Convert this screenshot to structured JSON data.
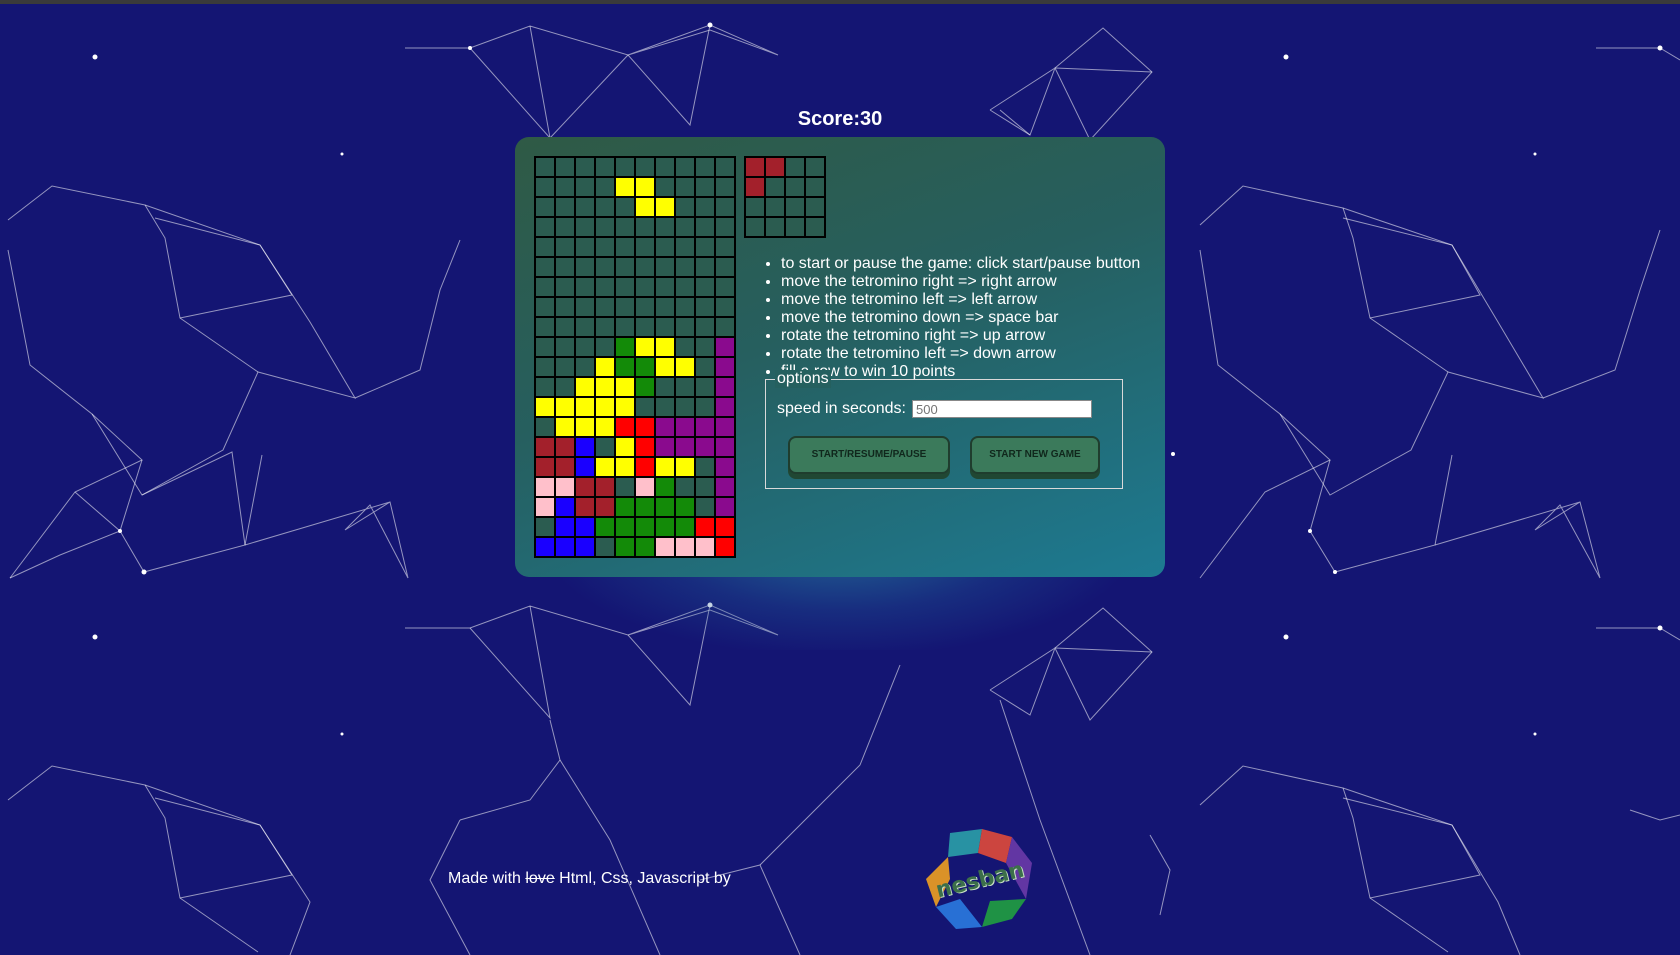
{
  "score": {
    "label": "Score:30",
    "value": 30
  },
  "board": {
    "columns": 10,
    "rows": 20,
    "colors": {
      ".": "#2b5c50",
      "Y": "#ffff00",
      "G": "#138a08",
      "P": "#8a0a8e",
      "R": "#ff0000",
      "M": "#a3202b",
      "B": "#1a00ff",
      "K": "#ffc0cb"
    },
    "grid": [
      "..........",
      "..........",
      "....YY....",
      ".....YY...",
      "..........",
      "..........",
      "..........",
      "..........",
      "..........",
      "..........",
      "....GYY..P",
      "...YGGYY.P",
      "..YYYG...P",
      "YYYYY....P",
      ".YYYRRPPPP",
      "MMB.YRPPPP",
      "MMBYYRYY.P",
      "KKMM.KG..P",
      "KBMMGGGG.P",
      ".BBGGGGGRR",
      "BBB.GGKKKR"
    ]
  },
  "next_piece": {
    "grid": [
      "MM..",
      "M...",
      "....",
      "...."
    ]
  },
  "instructions": [
    "to start or pause the game: click start/pause button",
    "move the tetromino right => right arrow",
    "move the tetromino left => left arrow",
    "move the tetromino down => space bar",
    "rotate the tetromino right => up arrow",
    "rotate the tetromino left => down arrow",
    "fill a row to win 10 points"
  ],
  "options": {
    "legend": "options",
    "speed_label": "speed in seconds:",
    "speed_placeholder": "500"
  },
  "buttons": {
    "start": "START/RESUME/PAUSE",
    "new_game": "START NEW GAME"
  },
  "footer": {
    "prefix": "Made with ",
    "struck": "love",
    "suffix": " Html, Css, Javascript by",
    "logo_text": "nesban"
  }
}
